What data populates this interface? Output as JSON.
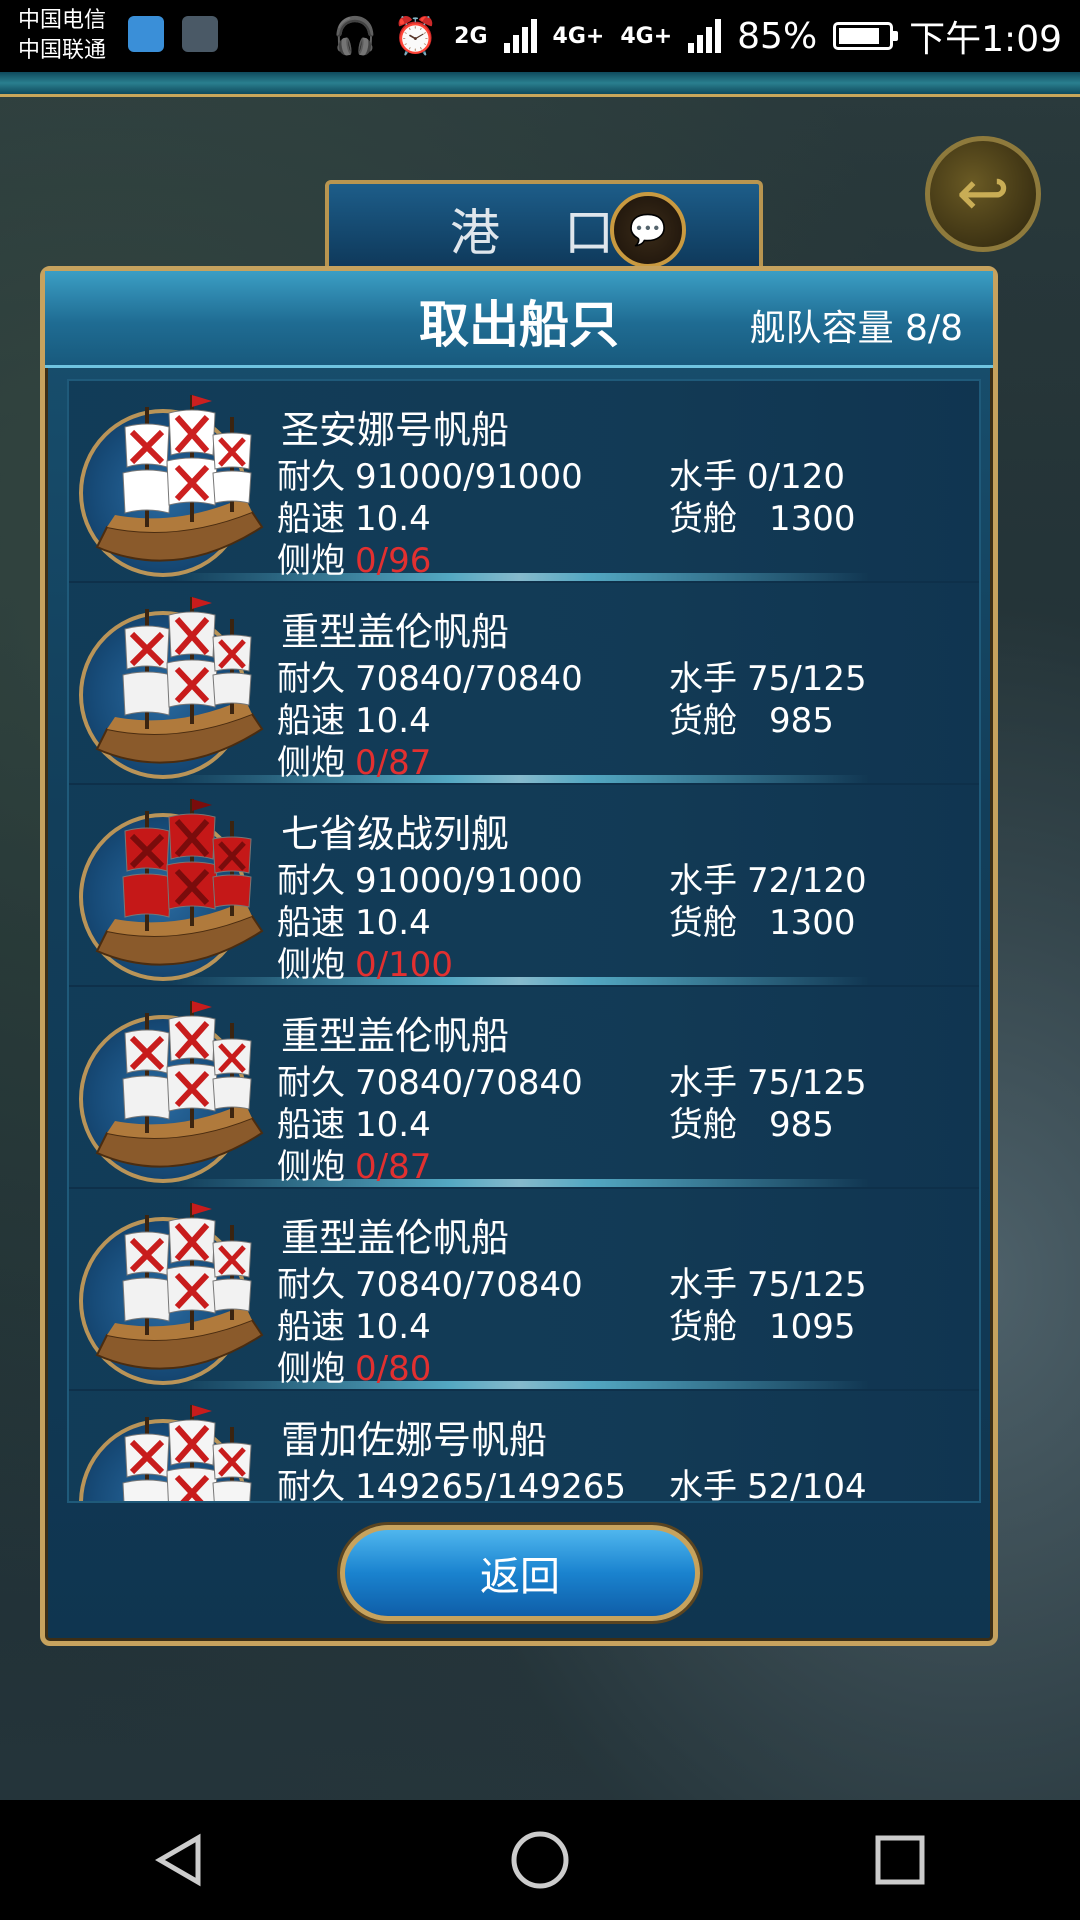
{
  "status_bar": {
    "carrier_1": "中国电信",
    "carrier_2": "中国联通",
    "network_2g": "2G",
    "network_4g_a": "4G+",
    "network_4g_b": "4G+",
    "battery_percent": "85%",
    "battery_level": 0.85,
    "time": "下午1:09"
  },
  "background": {
    "port_banner": "港 口",
    "chat_icon": "💬",
    "back_icon": "↩"
  },
  "dialog": {
    "title": "取出船只",
    "fleet_capacity": "舰队容量 8/8",
    "labels": {
      "durability": "耐久",
      "sailors": "水手",
      "speed": "船速",
      "cargo": "货舱",
      "cannons": "侧炮"
    },
    "ships": [
      {
        "name": "圣安娜号帆船",
        "durability": "91000/91000",
        "sailors": "0/120",
        "speed": "10.4",
        "cargo": "1300",
        "cannons": "0/96",
        "sail_color": "#ffffff",
        "cross_color": "#cc2020"
      },
      {
        "name": "重型盖伦帆船",
        "durability": "70840/70840",
        "sailors": "75/125",
        "speed": "10.4",
        "cargo": "985",
        "cannons": "0/87",
        "sail_color": "#f2f2f2",
        "cross_color": "#c81c1c"
      },
      {
        "name": "七省级战列舰",
        "durability": "91000/91000",
        "sailors": "72/120",
        "speed": "10.4",
        "cargo": "1300",
        "cannons": "0/100",
        "sail_color": "#c51818",
        "cross_color": "#7a0c0c"
      },
      {
        "name": "重型盖伦帆船",
        "durability": "70840/70840",
        "sailors": "75/125",
        "speed": "10.4",
        "cargo": "985",
        "cannons": "0/87",
        "sail_color": "#f2f2f2",
        "cross_color": "#c81c1c"
      },
      {
        "name": "重型盖伦帆船",
        "durability": "70840/70840",
        "sailors": "75/125",
        "speed": "10.4",
        "cargo": "1095",
        "cannons": "0/80",
        "sail_color": "#f2f2f2",
        "cross_color": "#c81c1c"
      },
      {
        "name": "雷加佐娜号帆船",
        "durability": "149265/149265",
        "sailors": "52/104",
        "speed": "",
        "cargo": "",
        "cannons": "",
        "sail_color": "#f5f5f5",
        "cross_color": "#c81c1c"
      }
    ],
    "return_button": "返回"
  },
  "accent_colors": {
    "gold_border": "#c6a25e",
    "panel_blue": "#123e5a",
    "cannon_red": "#e23030"
  }
}
